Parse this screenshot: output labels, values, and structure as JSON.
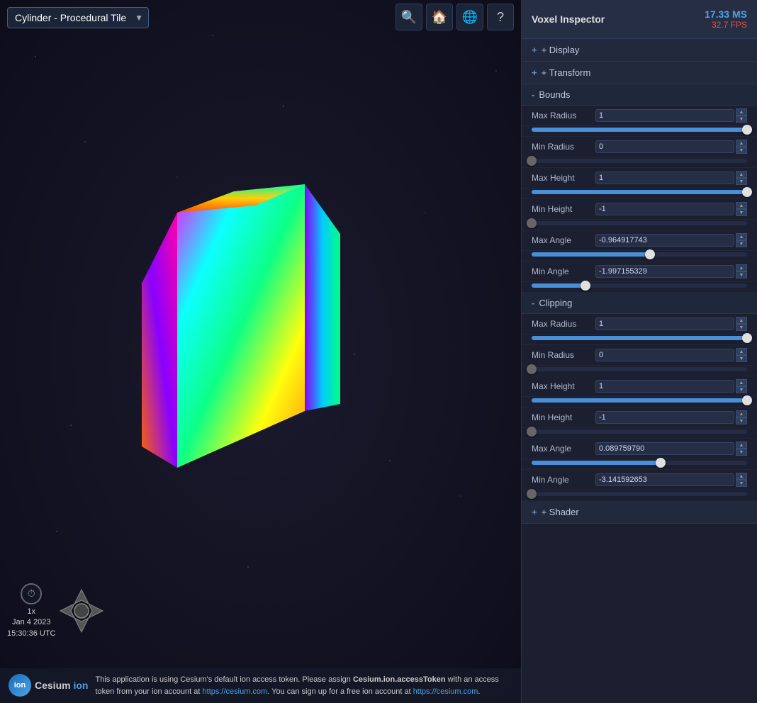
{
  "app": {
    "title": "Cylinder - Procedural Tile",
    "dropdown_options": [
      "Cylinder - Procedural Tile"
    ]
  },
  "topbar_icons": [
    {
      "name": "search-icon",
      "symbol": "🔍"
    },
    {
      "name": "home-icon",
      "symbol": "🏠"
    },
    {
      "name": "globe-icon",
      "symbol": "🌐"
    },
    {
      "name": "help-icon",
      "symbol": "?"
    }
  ],
  "inspector": {
    "title": "Voxel Inspector",
    "ms": "17.33 MS",
    "fps": "32.7 FPS",
    "sections": {
      "display": {
        "label": "+ Display",
        "expanded": false
      },
      "transform": {
        "label": "+ Transform",
        "expanded": false
      },
      "bounds": {
        "label": "- Bounds",
        "expanded": true,
        "properties": [
          {
            "label": "Max Radius",
            "value": "1",
            "slider_fill_pct": 100,
            "slider_thumb_pct": 100,
            "thumb_light": true
          },
          {
            "label": "Min Radius",
            "value": "0",
            "slider_fill_pct": 0,
            "slider_thumb_pct": 0,
            "thumb_light": true
          },
          {
            "label": "Max Height",
            "value": "1",
            "slider_fill_pct": 100,
            "slider_thumb_pct": 100,
            "thumb_light": true
          },
          {
            "label": "Min Height",
            "value": "-1",
            "slider_fill_pct": 0,
            "slider_thumb_pct": 0,
            "thumb_light": true
          },
          {
            "label": "Max Angle",
            "value": "-0.964917743",
            "slider_fill_pct": 55,
            "slider_thumb_pct": 55,
            "thumb_light": true
          },
          {
            "label": "Min Angle",
            "value": "-1.997155329",
            "slider_fill_pct": 25,
            "slider_thumb_pct": 25,
            "thumb_light": true
          }
        ]
      },
      "clipping": {
        "label": "- Clipping",
        "expanded": true,
        "properties": [
          {
            "label": "Max Radius",
            "value": "1",
            "slider_fill_pct": 100,
            "slider_thumb_pct": 100,
            "thumb_light": true
          },
          {
            "label": "Min Radius",
            "value": "0",
            "slider_fill_pct": 0,
            "slider_thumb_pct": 0,
            "thumb_light": true
          },
          {
            "label": "Max Height",
            "value": "1",
            "slider_fill_pct": 100,
            "slider_thumb_pct": 100,
            "thumb_light": true
          },
          {
            "label": "Min Height",
            "value": "-1",
            "slider_fill_pct": 0,
            "slider_thumb_pct": 0,
            "thumb_light": true
          },
          {
            "label": "Max Angle",
            "value": "0.089759790",
            "slider_fill_pct": 60,
            "slider_thumb_pct": 60,
            "thumb_light": true
          },
          {
            "label": "Min Angle",
            "value": "-3.141592653",
            "slider_fill_pct": 0,
            "slider_thumb_pct": 0,
            "thumb_light": true
          }
        ]
      },
      "shader": {
        "label": "+ Shader",
        "expanded": false
      }
    }
  },
  "clock": {
    "speed": "1x",
    "date": "Jan 4 2023",
    "time": "15:30:36 UTC"
  },
  "bottom_bar": {
    "token_warning": "This application is using Cesium's default ion access token. Please assign ",
    "token_name": "Cesium.ion.accessToken",
    "token_warning2": " with an access token from your ion account at",
    "cesium_url": "https://cesium.com",
    "cesium_url_text": "https://cesium.com",
    "token_warning3": ". You can sign up for a free ion account at ",
    "cesium_com": "https://cesium.com",
    "cesium_com_text": "https://cesium.com",
    "period": "."
  }
}
